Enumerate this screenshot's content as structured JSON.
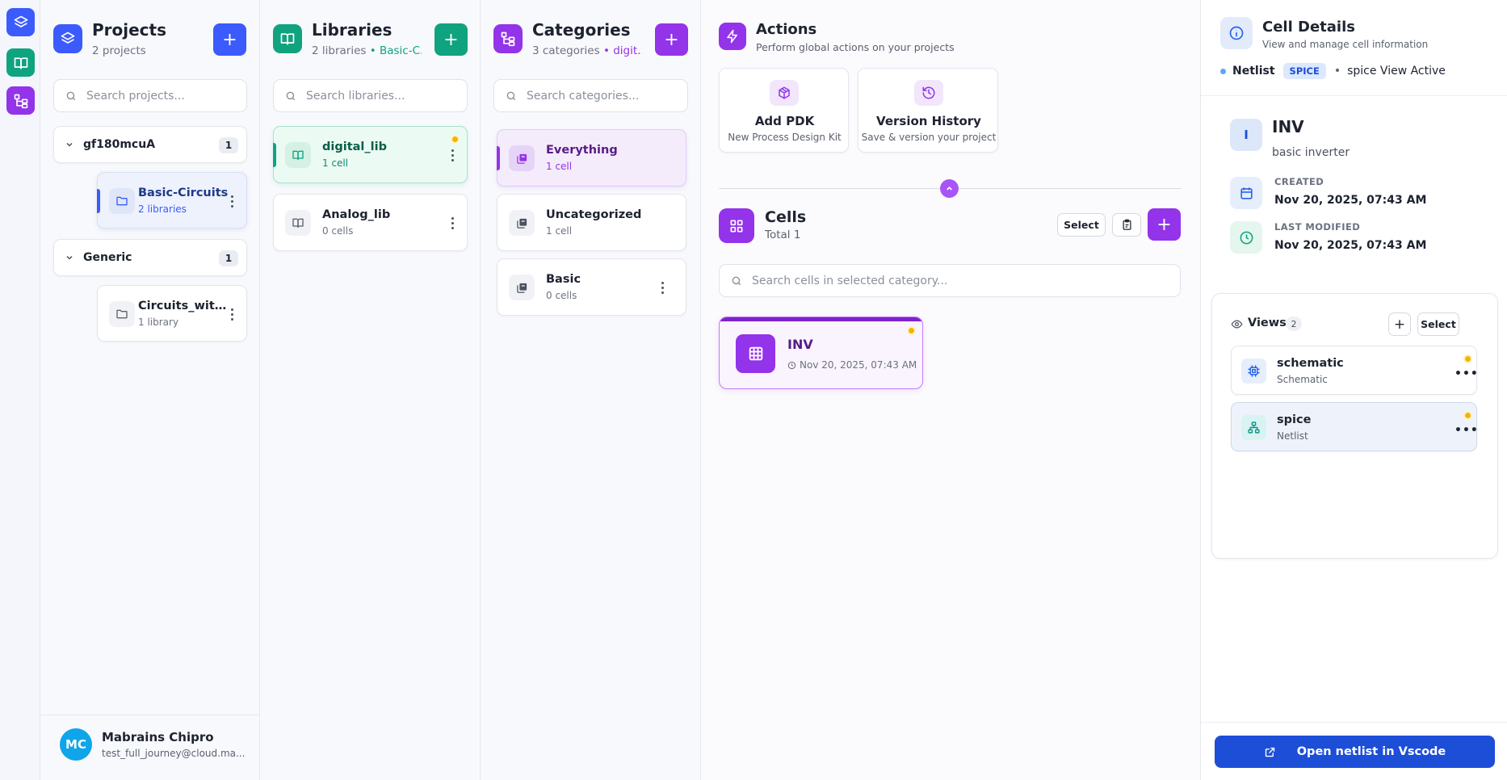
{
  "projects": {
    "title": "Projects",
    "subtitle": "2 projects",
    "search_placeholder": "Search projects...",
    "groups": [
      {
        "name": "gf180mcuA",
        "count": "1",
        "item": {
          "title": "Basic-Circuits",
          "sub": "2 libraries"
        }
      },
      {
        "name": "Generic",
        "count": "1",
        "item": {
          "title": "Circuits_without...",
          "sub": "1 library"
        }
      }
    ]
  },
  "libraries": {
    "title": "Libraries",
    "subtitle_count": "2 libraries",
    "subtitle_ctx": "• Basic-C...",
    "search_placeholder": "Search libraries...",
    "items": [
      {
        "title": "digital_lib",
        "sub": "1 cell"
      },
      {
        "title": "Analog_lib",
        "sub": "0 cells"
      }
    ]
  },
  "categories": {
    "title": "Categories",
    "subtitle_count": "3 categories",
    "subtitle_ctx": "• digit...",
    "search_placeholder": "Search categories...",
    "items": [
      {
        "title": "Everything",
        "sub": "1 cell"
      },
      {
        "title": "Uncategorized",
        "sub": "1 cell"
      },
      {
        "title": "Basic",
        "sub": "0 cells"
      }
    ]
  },
  "actions": {
    "title": "Actions",
    "subtitle": "Perform global actions on your projects",
    "cards": [
      {
        "title": "Add PDK",
        "sub": "New Process Design Kit"
      },
      {
        "title": "Version History",
        "sub": "Save & version your project"
      }
    ]
  },
  "cells": {
    "title": "Cells",
    "subtitle": "Total 1",
    "select_label": "Select",
    "search_placeholder": "Search cells in selected category...",
    "items": [
      {
        "title": "INV",
        "date": "Nov 20, 2025, 07:43 AM"
      }
    ]
  },
  "details": {
    "title": "Cell Details",
    "subtitle": "View and manage cell information",
    "view_type": "Netlist",
    "view_badge": "SPICE",
    "view_active": "spice View Active",
    "cell_initial": "I",
    "cell_name": "INV",
    "cell_desc": "basic inverter",
    "created_label": "CREATED",
    "created_value": "Nov 20, 2025, 07:43 AM",
    "modified_label": "LAST MODIFIED",
    "modified_value": "Nov 20, 2025, 07:43 AM",
    "views_label": "Views",
    "views_count": "2",
    "views_select": "Select",
    "views": [
      {
        "name": "schematic",
        "type": "Schematic"
      },
      {
        "name": "spice",
        "type": "Netlist"
      }
    ],
    "open_button": "Open netlist in Vscode"
  },
  "user": {
    "initials": "MC",
    "name": "Mabrains Chipro",
    "email": "test_full_journey@cloud.ma..."
  },
  "colors": {
    "blue": "#3b5bfd",
    "green": "#10a37f",
    "purple": "#9333ea",
    "primary_button": "#1d4ed8"
  }
}
